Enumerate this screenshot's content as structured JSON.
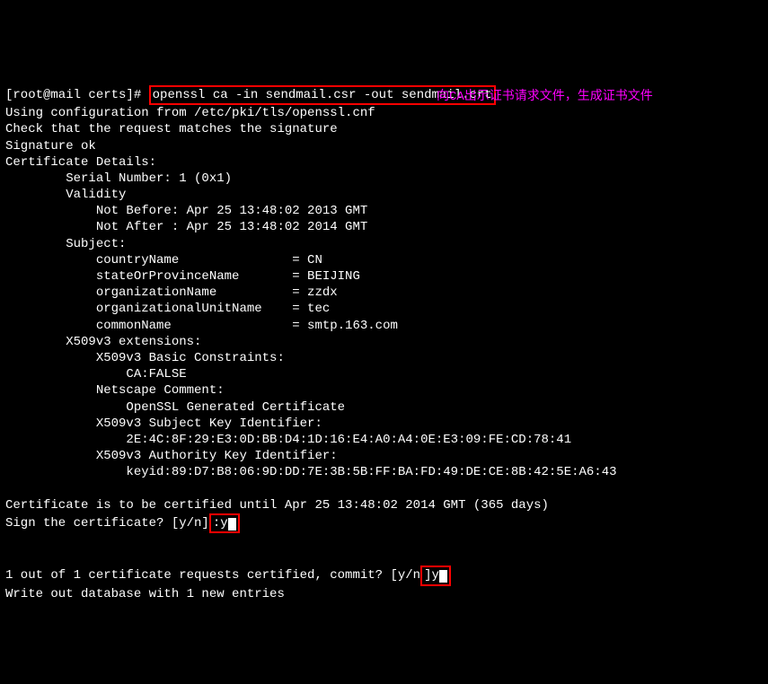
{
  "prompt": {
    "host": "[root@mail certs]# ",
    "cmd": "openssl ca -in sendmail.csr -out sendmail.crt"
  },
  "annotation": "向CA出示证书请求文件，生成证书文件",
  "lines": {
    "l01": "Using configuration from /etc/pki/tls/openssl.cnf",
    "l02": "Check that the request matches the signature",
    "l03": "Signature ok",
    "l04": "Certificate Details:",
    "l05": "        Serial Number: 1 (0x1)",
    "l06": "        Validity",
    "l07": "            Not Before: Apr 25 13:48:02 2013 GMT",
    "l08": "            Not After : Apr 25 13:48:02 2014 GMT",
    "l09": "        Subject:",
    "l10": "            countryName               = CN",
    "l11": "            stateOrProvinceName       = BEIJING",
    "l12": "            organizationName          = zzdx",
    "l13": "            organizationalUnitName    = tec",
    "l14": "            commonName                = smtp.163.com",
    "l15": "        X509v3 extensions:",
    "l16": "            X509v3 Basic Constraints:",
    "l17": "                CA:FALSE",
    "l18": "            Netscape Comment:",
    "l19": "                OpenSSL Generated Certificate",
    "l20": "            X509v3 Subject Key Identifier:",
    "l21": "                2E:4C:8F:29:E3:0D:BB:D4:1D:16:E4:A0:A4:0E:E3:09:FE:CD:78:41",
    "l22": "            X509v3 Authority Key Identifier:",
    "l23": "                keyid:89:D7:B8:06:9D:DD:7E:3B:5B:FF:BA:FD:49:DE:CE:8B:42:5E:A6:43",
    "l24": "",
    "l25a": "Certificate is to be certified until Apr 25 13:48:02 2014 GMT (365 days)",
    "l26a": "Sign the certificate? [y/n]",
    "l26b": ":y",
    "l27": "",
    "l28": "",
    "l29a": "1 out of 1 certificate requests certified, commit? [y/n",
    "l29b": "]y",
    "l30": "Write out database with 1 new entries"
  }
}
